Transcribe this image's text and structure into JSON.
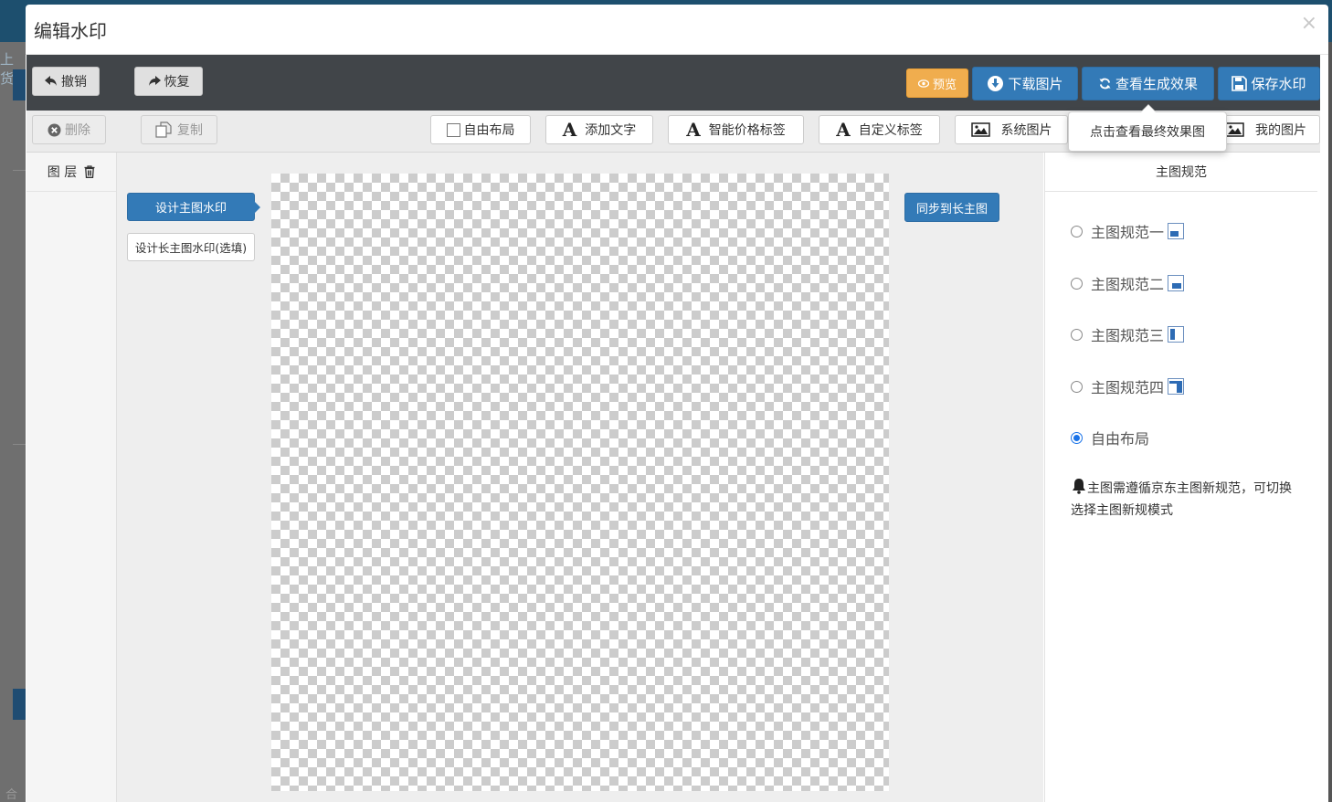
{
  "background": {
    "header_fragment": "上货",
    "footer_fragment": "合"
  },
  "modal": {
    "title": "编辑水印",
    "close": "×"
  },
  "toolbar": {
    "undo": "撤销",
    "redo": "恢复",
    "preview": "预览",
    "download": "下载图片",
    "view_result": "查看生成效果",
    "save": "保存水印"
  },
  "tooltip": "点击查看最终效果图",
  "edit_toolbar": {
    "delete": "删除",
    "copy": "复制",
    "free_layout": "自由布局",
    "add_text": "添加文字",
    "smart_price": "智能价格标签",
    "custom_label": "自定义标签",
    "system_image": "系统图片",
    "my_image": "我的图片"
  },
  "layer_panel": {
    "title": "图 层"
  },
  "workspace": {
    "tab_main": "设计主图水印",
    "tab_long": "设计长主图水印(选填)",
    "sync_button": "同步到长主图"
  },
  "spec_panel": {
    "title": "主图规范",
    "options": [
      {
        "label": "主图规范一",
        "selected": false
      },
      {
        "label": "主图规范二",
        "selected": false
      },
      {
        "label": "主图规范三",
        "selected": false
      },
      {
        "label": "主图规范四",
        "selected": false
      },
      {
        "label": "自由布局",
        "selected": true
      }
    ],
    "notice": "主图需遵循京东主图新规范，可切换选择主图新规模式"
  },
  "colors": {
    "primary_blue": "#337ab7",
    "warning_orange": "#f0ad4e",
    "toolbar_dark": "#414549",
    "radio_selected": "#1a73e8"
  },
  "icons": {
    "undo": "arrow-left-icon",
    "redo": "arrow-right-icon",
    "preview": "eye-icon",
    "download": "download-circle-icon",
    "view_result": "refresh-icon",
    "save": "floppy-disk-icon",
    "delete": "times-circle-icon",
    "copy": "copy-icon",
    "text": "letter-a-icon",
    "image": "picture-icon",
    "trash": "trash-icon",
    "notice": "bell-icon"
  }
}
